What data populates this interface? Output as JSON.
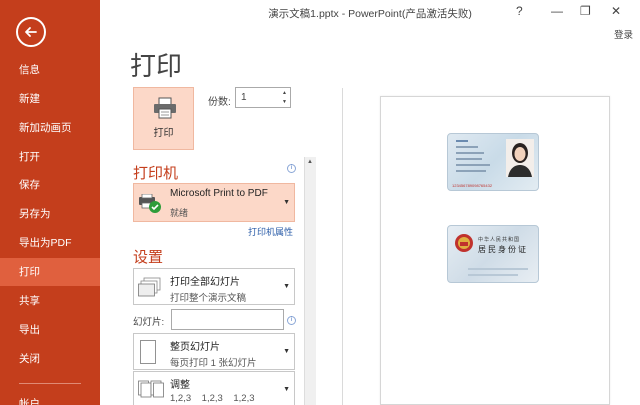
{
  "window": {
    "title": "演示文稿1.pptx - PowerPoint(产品激活失败)",
    "help": "?",
    "minimize": "—",
    "restore": "❐",
    "close": "✕",
    "login": "登录"
  },
  "sidebar": {
    "items": [
      {
        "label": "信息",
        "active": false
      },
      {
        "label": "新建",
        "active": false
      },
      {
        "label": "新加动画页",
        "active": false
      },
      {
        "label": "打开",
        "active": false
      },
      {
        "label": "保存",
        "active": false
      },
      {
        "label": "另存为",
        "active": false
      },
      {
        "label": "导出为PDF",
        "active": false
      },
      {
        "label": "打印",
        "active": true
      },
      {
        "label": "共享",
        "active": false
      },
      {
        "label": "导出",
        "active": false
      },
      {
        "label": "关闭",
        "active": false
      },
      {
        "label": "帐户",
        "active": false
      }
    ]
  },
  "print": {
    "title": "打印",
    "button_label": "打印",
    "copies_label": "份数:",
    "copies_value": "1"
  },
  "printer": {
    "heading": "打印机",
    "name": "Microsoft Print to PDF",
    "status": "就绪",
    "properties_link": "打印机属性"
  },
  "settings": {
    "heading": "设置",
    "range": {
      "title": "打印全部幻灯片",
      "subtitle": "打印整个演示文稿"
    },
    "slides_label": "幻灯片:",
    "slides_value": "",
    "layout": {
      "title": "整页幻灯片",
      "subtitle": "每页打印 1 张幻灯片"
    },
    "collate": {
      "title": "调整",
      "subtitle": "1,2,3    1,2,3    1,2,3"
    }
  },
  "preview": {
    "front_id_number": "123456789098765432",
    "back_line1": "中华人民共和国",
    "back_line2": "居民身份证"
  },
  "colors": {
    "accent": "#c43e1c",
    "sidebar_active": "#e0603e",
    "selected_fill": "#fcd8c8"
  }
}
